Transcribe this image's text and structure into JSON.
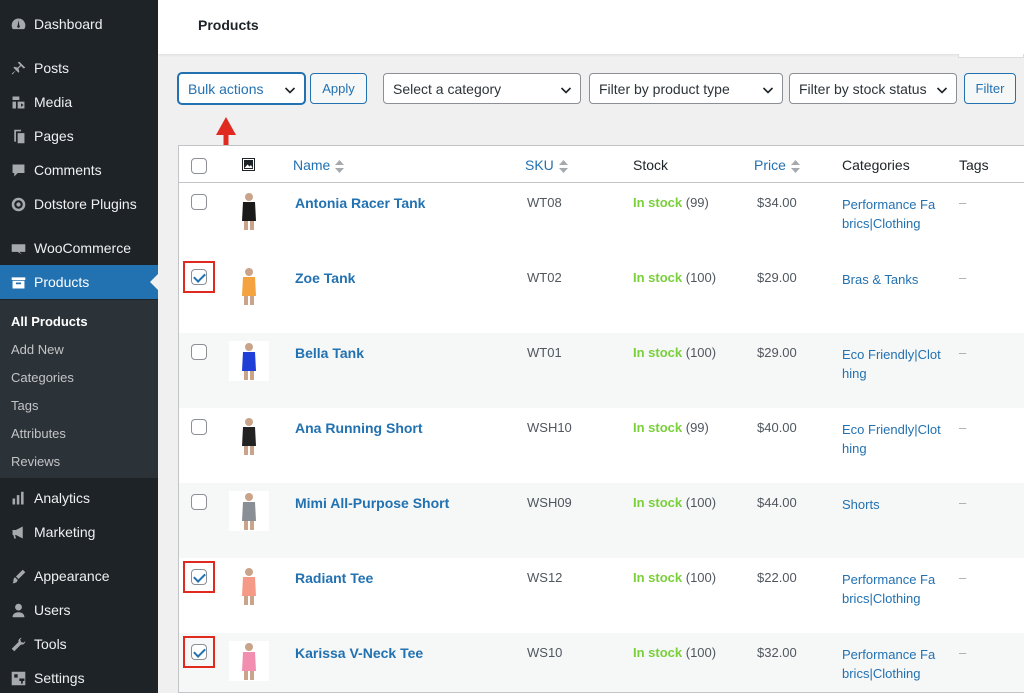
{
  "sidebar": {
    "items": [
      {
        "label": "Dashboard",
        "icon": "dashboard-icon"
      },
      {
        "label": "Posts",
        "icon": "pushpin-icon"
      },
      {
        "label": "Media",
        "icon": "media-icon"
      },
      {
        "label": "Pages",
        "icon": "pages-icon"
      },
      {
        "label": "Comments",
        "icon": "comments-icon"
      },
      {
        "label": "Dotstore Plugins",
        "icon": "target-icon"
      },
      {
        "label": "WooCommerce",
        "icon": "woo-icon"
      },
      {
        "label": "Products",
        "icon": "archive-icon"
      },
      {
        "label": "Analytics",
        "icon": "bar-chart-icon"
      },
      {
        "label": "Marketing",
        "icon": "megaphone-icon"
      },
      {
        "label": "Appearance",
        "icon": "brush-icon"
      },
      {
        "label": "Users",
        "icon": "user-icon"
      },
      {
        "label": "Tools",
        "icon": "wrench-icon"
      },
      {
        "label": "Settings",
        "icon": "settings-icon"
      }
    ],
    "submenu": [
      "All Products",
      "Add New",
      "Categories",
      "Tags",
      "Attributes",
      "Reviews"
    ]
  },
  "header": {
    "title": "Products"
  },
  "filters": {
    "bulk_actions": "Bulk actions",
    "apply": "Apply",
    "category": "Select a category",
    "product_type": "Filter by product type",
    "stock_status": "Filter by stock status",
    "filter": "Filter"
  },
  "table": {
    "headers": {
      "name": "Name",
      "sku": "SKU",
      "stock": "Stock",
      "price": "Price",
      "categories": "Categories",
      "tags": "Tags"
    },
    "rows": [
      {
        "name": "Antonia Racer Tank",
        "sku": "WT08",
        "stock_status": "In stock",
        "stock_qty": "(99)",
        "price": "$34.00",
        "categories": "Performance Fabrics|Clothing",
        "tags": "–",
        "checked": false,
        "thumb_color": "#1a1a1a"
      },
      {
        "name": "Zoe Tank",
        "sku": "WT02",
        "stock_status": "In stock",
        "stock_qty": "(100)",
        "price": "$29.00",
        "categories": "Bras & Tanks",
        "tags": "–",
        "checked": true,
        "thumb_color": "#f4a340"
      },
      {
        "name": "Bella Tank",
        "sku": "WT01",
        "stock_status": "In stock",
        "stock_qty": "(100)",
        "price": "$29.00",
        "categories": "Eco Friendly|Clothing",
        "tags": "–",
        "checked": false,
        "thumb_color": "#1f3fd6"
      },
      {
        "name": "Ana Running Short",
        "sku": "WSH10",
        "stock_status": "In stock",
        "stock_qty": "(99)",
        "price": "$40.00",
        "categories": "Eco Friendly|Clothing",
        "tags": "–",
        "checked": false,
        "thumb_color": "#222222"
      },
      {
        "name": "Mimi All-Purpose Short",
        "sku": "WSH09",
        "stock_status": "In stock",
        "stock_qty": "(100)",
        "price": "$44.00",
        "categories": "Shorts",
        "tags": "–",
        "checked": false,
        "thumb_color": "#8a8f96"
      },
      {
        "name": "Radiant Tee",
        "sku": "WS12",
        "stock_status": "In stock",
        "stock_qty": "(100)",
        "price": "$22.00",
        "categories": "Performance Fabrics|Clothing",
        "tags": "–",
        "checked": true,
        "thumb_color": "#f49a86"
      },
      {
        "name": "Karissa V-Neck Tee",
        "sku": "WS10",
        "stock_status": "In stock",
        "stock_qty": "(100)",
        "price": "$32.00",
        "categories": "Performance Fabrics|Clothing",
        "tags": "–",
        "checked": true,
        "thumb_color": "#f28fb0"
      }
    ]
  },
  "colors": {
    "accent": "#2271b1",
    "in_stock": "#7ad03a",
    "annotation": "#e02a20",
    "sidebar": "#1d2327"
  }
}
